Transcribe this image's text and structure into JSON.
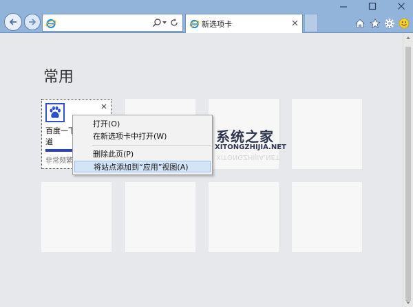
{
  "tab": {
    "label": "新选项卡"
  },
  "page": {
    "heading": "常用"
  },
  "active_tile": {
    "title": "百度一下，你就知道",
    "meta": "非常频繁"
  },
  "context_menu": {
    "items": [
      {
        "label": "打开(O)"
      },
      {
        "label": "在新选项卡中打开(W)"
      },
      {
        "label": "删除此页(P)"
      },
      {
        "label": "将站点添加到“应用”视图(A)"
      }
    ]
  },
  "watermark": {
    "name": "系统之家",
    "url": "XITONGZHIJIA.NET"
  },
  "colors": {
    "chrome": "#93b4da",
    "content_bg": "#e6e8ec",
    "tile_bg": "#f7f7f7",
    "menu_highlight": "#d4e4f7",
    "accent": "#2741c9"
  },
  "icons": [
    "back-arrow-icon",
    "forward-arrow-icon",
    "ie-logo-icon",
    "search-icon",
    "dropdown-icon",
    "refresh-icon",
    "close-icon",
    "home-icon",
    "favorites-star-icon",
    "gear-icon",
    "smiley-icon",
    "baidu-paw-icon"
  ]
}
